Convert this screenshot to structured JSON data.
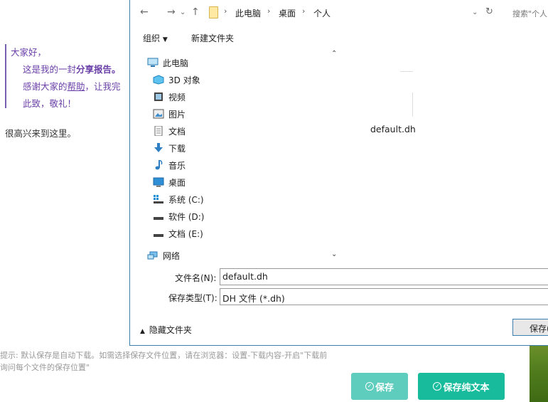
{
  "page": {
    "letter": {
      "line1": "大家好，",
      "line2_pre": "这是我的一封",
      "line2_bold": "分享报告。",
      "line3_pre": "感谢大家的",
      "line3_link": "帮助",
      "line3_post": "，让我完",
      "line4": "此致，敬礼！"
    },
    "welcome": "很高兴来到这里。",
    "hint_line1": "提示: 默认保存是自动下载。如需选择保存文件位置，请在浏览器：设置-下载内容-开启\"下载前",
    "hint_line2": "询问每个文件的保存位置\"",
    "save_button": "保存",
    "save_plain_button": "保存纯文本"
  },
  "dialog": {
    "breadcrumb": [
      "此电脑",
      "桌面",
      "个人"
    ],
    "search_placeholder": "搜索\"个人\"",
    "toolbar": {
      "organize": "组织",
      "new_folder": "新建文件夹"
    },
    "nav": {
      "this_pc": "此电脑",
      "objects3d": "3D 对象",
      "videos": "视频",
      "pictures": "图片",
      "documents": "文档",
      "downloads": "下载",
      "music": "音乐",
      "desktop": "桌面",
      "drive_c": "系统 (C:)",
      "drive_d": "软件 (D:)",
      "drive_e": "文档 (E:)",
      "network": "网络"
    },
    "file_name_shown": "default.dh",
    "filename_label": "文件名(N):",
    "filename_value": "default.dh",
    "filetype_label": "保存类型(T):",
    "filetype_value": "DH 文件 (*.dh)",
    "hide_folders": "隐藏文件夹",
    "save_label": "保存(S)"
  }
}
